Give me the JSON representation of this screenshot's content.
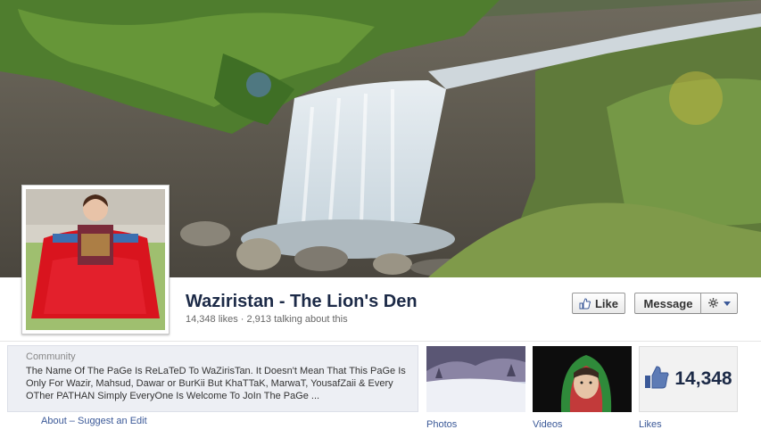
{
  "page": {
    "title": "Waziristan - The Lion's Den",
    "stats": "14,348 likes · 2,913 talking about this"
  },
  "actions": {
    "like_label": "Like",
    "message_label": "Message"
  },
  "about": {
    "category": "Community",
    "description": "The Name Of The PaGe Is ReLaTeD To WaZirisTan. It Doesn't Mean That This PaGe Is Only For Wazir, Mahsud, Dawar or BurKii But KhaTTaK, MarwaT, YousafZaii & Every OTher PATHAN Simply EveryOne Is Welcome To JoIn The PaGe ...",
    "about_link": "About",
    "separator": " – ",
    "suggest_link": "Suggest an Edit"
  },
  "apps": {
    "photos_label": "Photos",
    "videos_label": "Videos",
    "likes_label": "Likes",
    "likes_count": "14,348"
  },
  "colors": {
    "link": "#3b5998",
    "title": "#1c2a47"
  },
  "icons": {
    "like": "thumbs-up-icon",
    "gear": "gear-icon",
    "caret": "chevron-down-icon"
  }
}
